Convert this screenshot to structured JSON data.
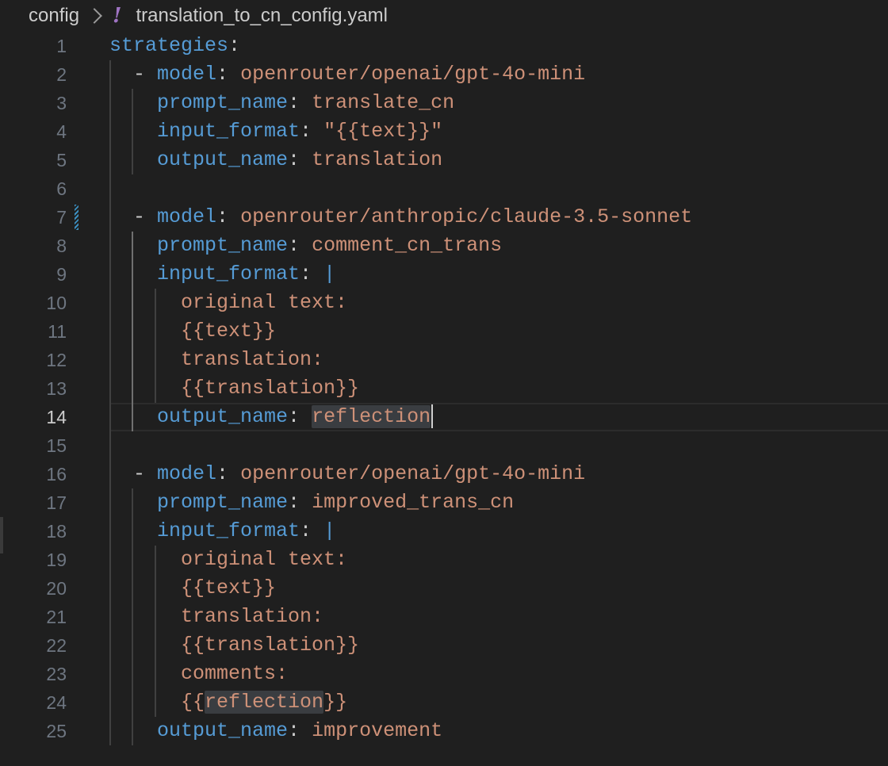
{
  "breadcrumb": {
    "folder": "config",
    "file_icon": "exclamation-yaml-icon",
    "file": "translation_to_cn_config.yaml"
  },
  "cursor_line": 14,
  "lines": [
    {
      "num": "1",
      "indent": "",
      "dash": false,
      "key": "strategies",
      "sep": ":",
      "value": "",
      "pipe": false
    },
    {
      "num": "2",
      "indent": "  ",
      "dash": true,
      "key": "model",
      "sep": ": ",
      "value": "openrouter/openai/gpt-4o-mini",
      "pipe": false
    },
    {
      "num": "3",
      "indent": "    ",
      "dash": false,
      "key": "prompt_name",
      "sep": ": ",
      "value": "translate_cn",
      "pipe": false
    },
    {
      "num": "4",
      "indent": "    ",
      "dash": false,
      "key": "input_format",
      "sep": ": ",
      "value": "\"{{text}}\"",
      "pipe": false
    },
    {
      "num": "5",
      "indent": "    ",
      "dash": false,
      "key": "output_name",
      "sep": ": ",
      "value": "translation",
      "pipe": false
    },
    {
      "num": "6",
      "indent": "",
      "dash": false,
      "key": "",
      "sep": "",
      "value": "",
      "pipe": false
    },
    {
      "num": "7",
      "indent": "  ",
      "dash": true,
      "key": "model",
      "sep": ": ",
      "value": "openrouter/anthropic/claude-3.5-sonnet",
      "pipe": false
    },
    {
      "num": "8",
      "indent": "    ",
      "dash": false,
      "key": "prompt_name",
      "sep": ": ",
      "value": "comment_cn_trans",
      "pipe": false
    },
    {
      "num": "9",
      "indent": "    ",
      "dash": false,
      "key": "input_format",
      "sep": ": ",
      "value": "",
      "pipe": true
    },
    {
      "num": "10",
      "indent": "      ",
      "dash": false,
      "key": "",
      "sep": "",
      "value": "original text:",
      "pipe": false
    },
    {
      "num": "11",
      "indent": "      ",
      "dash": false,
      "key": "",
      "sep": "",
      "value": "{{text}}",
      "pipe": false
    },
    {
      "num": "12",
      "indent": "      ",
      "dash": false,
      "key": "",
      "sep": "",
      "value": "translation:",
      "pipe": false
    },
    {
      "num": "13",
      "indent": "      ",
      "dash": false,
      "key": "",
      "sep": "",
      "value": "{{translation}}",
      "pipe": false
    },
    {
      "num": "14",
      "indent": "    ",
      "dash": false,
      "key": "output_name",
      "sep": ": ",
      "value": "",
      "hl": "reflection",
      "cursor": true,
      "pipe": false
    },
    {
      "num": "15",
      "indent": "",
      "dash": false,
      "key": "",
      "sep": "",
      "value": "",
      "pipe": false
    },
    {
      "num": "16",
      "indent": "  ",
      "dash": true,
      "key": "model",
      "sep": ": ",
      "value": "openrouter/openai/gpt-4o-mini",
      "pipe": false
    },
    {
      "num": "17",
      "indent": "    ",
      "dash": false,
      "key": "prompt_name",
      "sep": ": ",
      "value": "improved_trans_cn",
      "pipe": false
    },
    {
      "num": "18",
      "indent": "    ",
      "dash": false,
      "key": "input_format",
      "sep": ": ",
      "value": "",
      "pipe": true
    },
    {
      "num": "19",
      "indent": "      ",
      "dash": false,
      "key": "",
      "sep": "",
      "value": "original text:",
      "pipe": false
    },
    {
      "num": "20",
      "indent": "      ",
      "dash": false,
      "key": "",
      "sep": "",
      "value": "{{text}}",
      "pipe": false
    },
    {
      "num": "21",
      "indent": "      ",
      "dash": false,
      "key": "",
      "sep": "",
      "value": "translation:",
      "pipe": false
    },
    {
      "num": "22",
      "indent": "      ",
      "dash": false,
      "key": "",
      "sep": "",
      "value": "{{translation}}",
      "pipe": false
    },
    {
      "num": "23",
      "indent": "      ",
      "dash": false,
      "key": "",
      "sep": "",
      "value": "comments:",
      "pipe": false
    },
    {
      "num": "24",
      "indent": "      ",
      "dash": false,
      "key": "",
      "sep": "",
      "value": "{{",
      "hl": "reflection",
      "after": "}}",
      "pipe": false
    },
    {
      "num": "25",
      "indent": "    ",
      "dash": false,
      "key": "output_name",
      "sep": ": ",
      "value": "improvement",
      "pipe": false
    }
  ],
  "colors": {
    "background": "#1f1f1f",
    "key": "#569cd6",
    "value": "#ce9178",
    "line_number": "#6e7681",
    "highlight": "#3a3d41"
  }
}
